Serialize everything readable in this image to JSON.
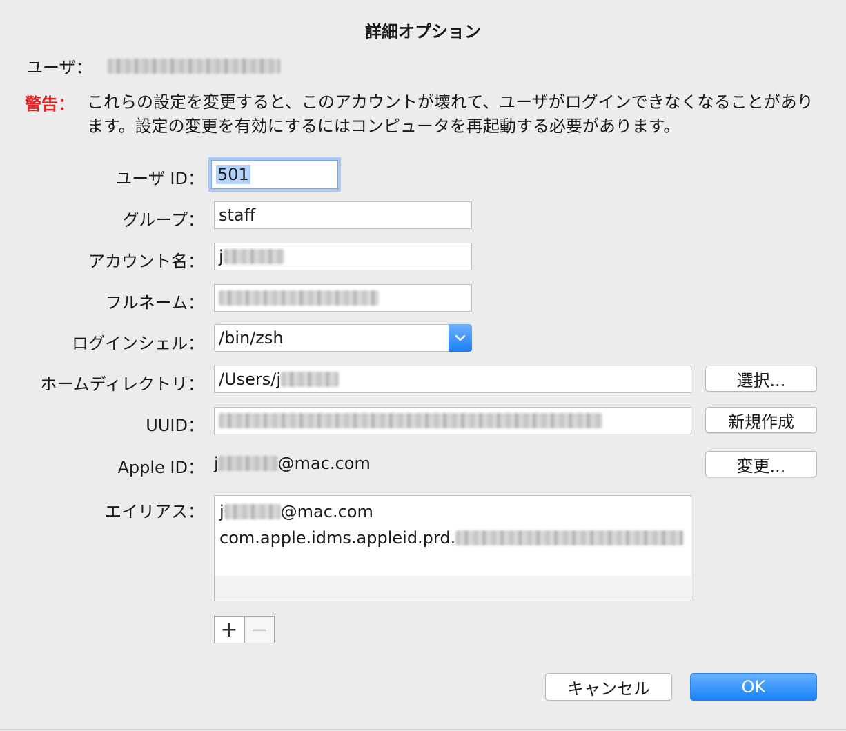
{
  "dialog": {
    "title": "詳細オプション"
  },
  "user": {
    "label": "ユーザ："
  },
  "warning": {
    "label": "警告：",
    "text": "これらの設定を変更すると、このアカウントが壊れて、ユーザがログインできなくなることがあります。設定の変更を有効にするにはコンピュータを再起動する必要があります。"
  },
  "fields": {
    "user_id": {
      "label": "ユーザ ID：",
      "value": "501"
    },
    "group": {
      "label": "グループ：",
      "value": "staff"
    },
    "account_name": {
      "label": "アカウント名：",
      "value": "j"
    },
    "full_name": {
      "label": "フルネーム："
    },
    "login_shell": {
      "label": "ログインシェル：",
      "value": "/bin/zsh"
    },
    "home_dir": {
      "label": "ホームディレクトリ：",
      "value": "/Users/j"
    },
    "uuid": {
      "label": "UUID："
    },
    "apple_id": {
      "label": "Apple ID：",
      "prefix": "j",
      "suffix": "@mac.com"
    },
    "aliases": {
      "label": "エイリアス：",
      "items": [
        {
          "prefix": "j",
          "suffix": "@mac.com"
        },
        {
          "prefix": "com.apple.idms.appleid.prd.",
          "suffix": ""
        }
      ]
    }
  },
  "buttons": {
    "choose": "選択...",
    "new": "新規作成",
    "change": "変更...",
    "add": "+",
    "remove": "−",
    "cancel": "キャンセル",
    "ok": "OK"
  },
  "colors": {
    "warning": "#e02424",
    "accent": "#1a82f7",
    "focus_ring": "#a9c9f2"
  },
  "icons": {
    "popup": "chevron-down-icon"
  }
}
